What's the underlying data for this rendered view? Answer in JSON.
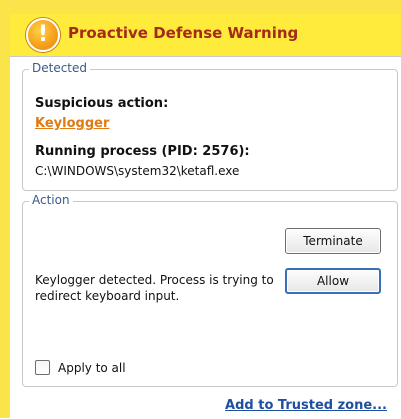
{
  "window": {
    "title": "Proactive Defense Warning",
    "icon": "warning-icon",
    "accent_color": "#fbe44a",
    "title_color": "#a52a1a"
  },
  "detected": {
    "legend": "Detected",
    "suspicious_label": "Suspicious action:",
    "suspicious_value": "Keylogger",
    "process_label": "Running process (PID: 2576):",
    "process_path": "C:\\WINDOWS\\system32\\ketafl.exe"
  },
  "action": {
    "legend": "Action",
    "terminate_label": "Terminate",
    "allow_label": "Allow",
    "description": "Keylogger detected. Process is trying to redirect keyboard input.",
    "apply_all_label": "Apply to all",
    "apply_all_checked": false
  },
  "footer": {
    "trusted_link": "Add to Trusted zone..."
  }
}
